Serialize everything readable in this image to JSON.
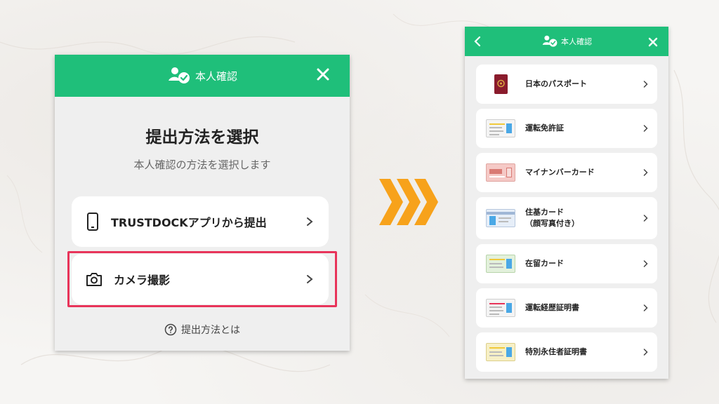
{
  "left_panel": {
    "header_title": "本人確認",
    "main_title": "提出方法を選択",
    "subtitle": "本人確認の方法を選択します",
    "options": [
      {
        "label": "TRUSTDOCKアプリから提出",
        "icon": "smartphone-icon"
      },
      {
        "label": "カメラ撮影",
        "icon": "camera-icon"
      }
    ],
    "help_text": "提出方法とは",
    "highlight_color": "#e8345a"
  },
  "right_panel": {
    "header_title": "本人確認",
    "documents": [
      {
        "label": "日本のパスポート",
        "icon": "passport-icon"
      },
      {
        "label": "運転免許証",
        "icon": "drivers-license-icon"
      },
      {
        "label": "マイナンバーカード",
        "icon": "my-number-card-icon"
      },
      {
        "label": "住基カード",
        "label2": "（顔写真付き）",
        "icon": "juki-card-icon"
      },
      {
        "label": "在留カード",
        "icon": "residence-card-icon"
      },
      {
        "label": "運転経歴証明書",
        "icon": "driving-history-cert-icon"
      },
      {
        "label": "特別永住者証明書",
        "icon": "special-permanent-resident-icon"
      }
    ]
  },
  "colors": {
    "brand_green": "#1fbf7a",
    "arrow_orange": "#f7a21b"
  }
}
